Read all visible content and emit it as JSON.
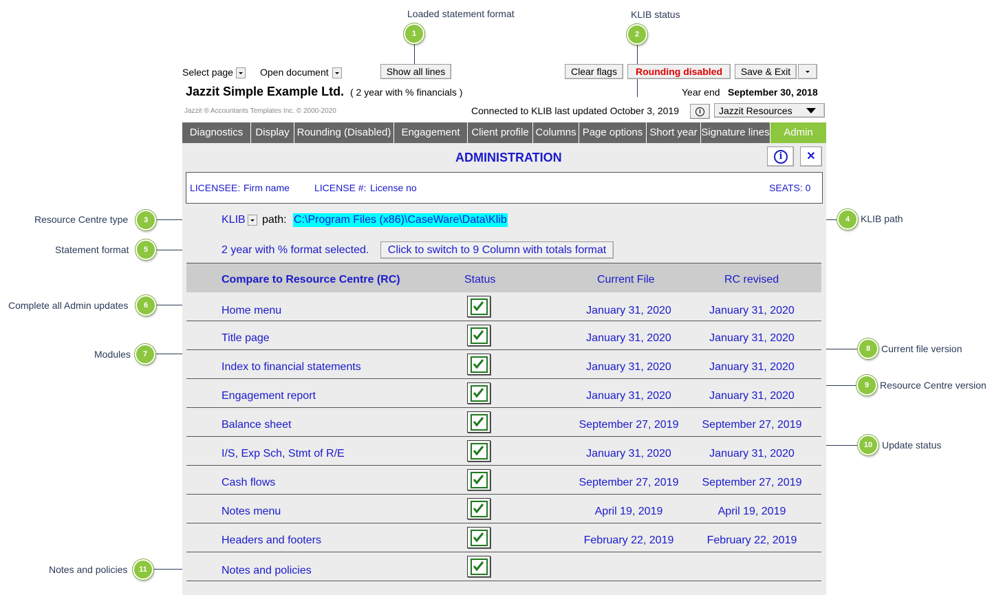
{
  "callouts": {
    "c1": {
      "num": "1",
      "text": "Loaded statement format"
    },
    "c2": {
      "num": "2",
      "text": "KLIB status"
    },
    "c3": {
      "num": "3",
      "text": "Resource Centre type"
    },
    "c4": {
      "num": "4",
      "text": "KLIB path"
    },
    "c5": {
      "num": "5",
      "text": "Statement format"
    },
    "c6": {
      "num": "6",
      "text": "Complete all Admin updates"
    },
    "c7": {
      "num": "7",
      "text": "Modules"
    },
    "c8": {
      "num": "8",
      "text": "Current file version"
    },
    "c9": {
      "num": "9",
      "text": "Resource Centre version"
    },
    "c10": {
      "num": "10",
      "text": "Update status"
    },
    "c11": {
      "num": "11",
      "text": "Notes and policies"
    }
  },
  "toolbar": {
    "select_page": "Select page",
    "open_document": "Open document",
    "show_all_lines": "Show all lines",
    "clear_flags": "Clear flags",
    "rounding_disabled": "Rounding disabled",
    "save_exit": "Save & Exit"
  },
  "header": {
    "company": "Jazzit Simple Example Ltd.",
    "format": "( 2 year with % financials )",
    "year_end_label": "Year end",
    "year_end_value": "September 30, 2018",
    "copyright": "Jazzit ®  Accountants Templates Inc.  © 2000-2020",
    "klib_status": "Connected to KLIB last updated October 3, 2019",
    "resources_label": "Jazzit Resources"
  },
  "tabs": [
    "Diagnostics",
    "Display",
    "Rounding (Disabled)",
    "Engagement",
    "Client profile",
    "Columns",
    "Page options",
    "Short year",
    "Signature lines",
    "Admin"
  ],
  "admin": {
    "title": "ADMINISTRATION",
    "licensee_label": "LICENSEE:",
    "licensee_value": "Firm name",
    "license_label": "LICENSE #:",
    "license_value": "License no",
    "seats": "SEATS: 0",
    "klib_type": "KLIB",
    "path_label": "path:",
    "path_value": "C:\\Program Files (x86)\\CaseWare\\Data\\Klib",
    "format_selected": "2 year with % format selected.",
    "switch_button": "Click to switch to 9 Column with totals format"
  },
  "table": {
    "headers": [
      "Compare to Resource Centre (RC)",
      "Status",
      "Current File",
      "RC revised"
    ],
    "rows": [
      {
        "module": "Home menu",
        "current": "January 31, 2020",
        "rc": "January 31, 2020",
        "checked": true
      },
      {
        "module": "Title page",
        "current": "January 31, 2020",
        "rc": "January 31, 2020",
        "checked": true
      },
      {
        "module": "Index to financial statements",
        "current": "January 31, 2020",
        "rc": "January 31, 2020",
        "checked": true
      },
      {
        "module": "Engagement report",
        "current": "January 31, 2020",
        "rc": "January 31, 2020",
        "checked": true
      },
      {
        "module": "Balance sheet",
        "current": "September 27, 2019",
        "rc": "September 27, 2019",
        "checked": true
      },
      {
        "module": "I/S, Exp Sch, Stmt of R/E",
        "current": "January 31, 2020",
        "rc": "January 31, 2020",
        "checked": true
      },
      {
        "module": "Cash flows",
        "current": "September 27, 2019",
        "rc": "September 27, 2019",
        "checked": true
      },
      {
        "module": "Notes menu",
        "current": "April 19, 2019",
        "rc": "April 19, 2019",
        "checked": true
      },
      {
        "module": "Headers and footers",
        "current": "February 22, 2019",
        "rc": "February 22, 2019",
        "checked": true
      },
      {
        "module": "Notes and policies",
        "current": "",
        "rc": "",
        "checked": true
      }
    ]
  },
  "colors": {
    "accent": "#8dc63f",
    "tab_bg": "#666666",
    "link_blue": "#1a1acc",
    "rounding_red": "#e00000",
    "path_highlight": "#00ffff"
  }
}
